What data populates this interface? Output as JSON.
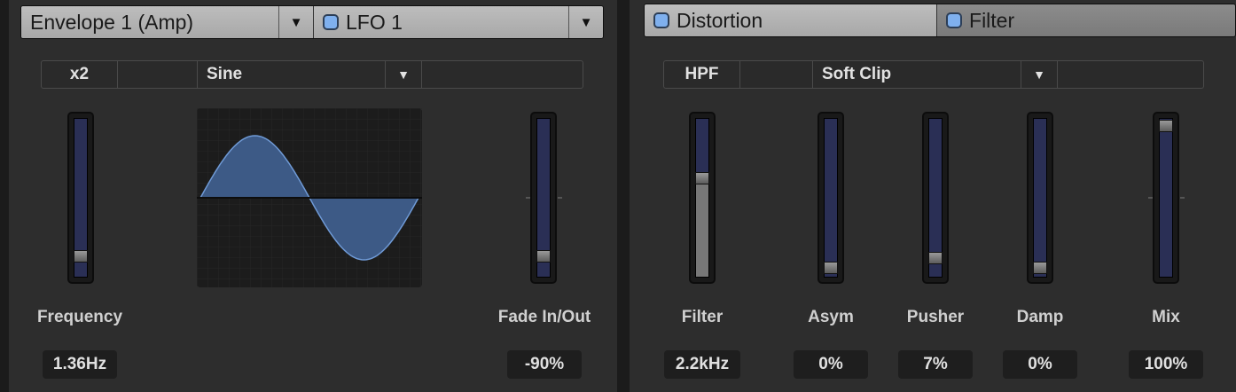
{
  "left": {
    "envelope_tab": "Envelope 1 (Amp)",
    "lfo_tab": "LFO 1",
    "options": {
      "multiplier": "x2",
      "shape": "Sine"
    },
    "sliders": [
      {
        "id": "frequency",
        "label": "Frequency",
        "value": "1.36Hz",
        "level": 0.08
      },
      {
        "id": "fade",
        "label": "Fade In/Out",
        "value": "-90%",
        "level": 0.08
      }
    ]
  },
  "right": {
    "distortion_tab": "Distortion",
    "filter_tab": "Filter",
    "options": {
      "filter_mode": "HPF",
      "type": "Soft Clip"
    },
    "sliders": [
      {
        "id": "filter",
        "label": "Filter",
        "value": "2.2kHz",
        "level": 0.63
      },
      {
        "id": "asym",
        "label": "Asym",
        "value": "0%",
        "level": 0.0
      },
      {
        "id": "pusher",
        "label": "Pusher",
        "value": "7%",
        "level": 0.07
      },
      {
        "id": "damp",
        "label": "Damp",
        "value": "0%",
        "level": 0.0
      },
      {
        "id": "mix",
        "label": "Mix",
        "value": "100%",
        "level": 1.0
      }
    ]
  },
  "colors": {
    "track": "#2a2f55",
    "toggle": "#7fb0ee",
    "wave": "#3f5f8f"
  },
  "icons": {
    "dropdown": "caret-down-icon",
    "toggle": "toggle-led-icon"
  }
}
